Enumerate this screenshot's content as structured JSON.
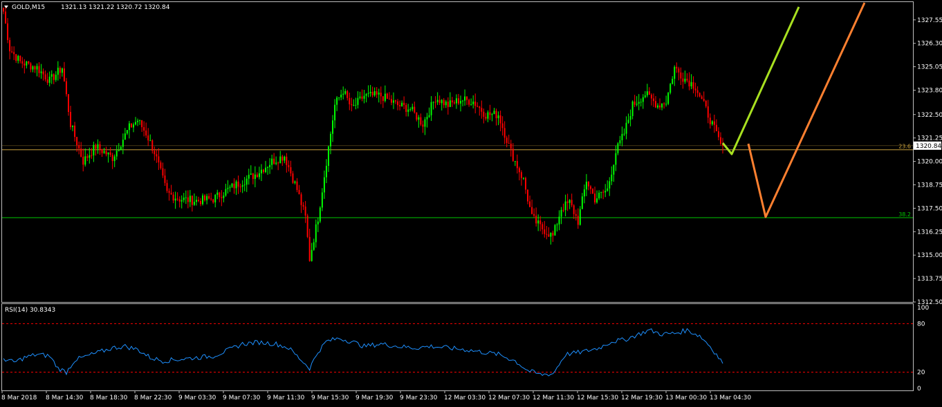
{
  "header": {
    "symbol": "GOLD,M15",
    "ohlc": "1321.13 1321.22 1320.72 1320.84"
  },
  "indicator": {
    "label": "RSI(14) 30.8343"
  },
  "colors": {
    "background": "#000000",
    "frame": "#c0c0c0",
    "bull": "#00ff00",
    "bear": "#ff0000",
    "rsi_line": "#1e90ff",
    "rsi_levels": "#ff0000",
    "fib_23": "#c8a03c",
    "fib_38": "#00c800",
    "arrow_up": "#a8e020",
    "arrow_down_up": "#ff8030"
  },
  "chart_data": [
    {
      "type": "candlestick",
      "title": "GOLD,M15",
      "ylim": [
        1312.5,
        1328.5
      ],
      "y_ticks": [
        "1327.55",
        "1326.30",
        "1325.05",
        "1323.80",
        "1322.50",
        "1321.25",
        "1320.00",
        "1318.75",
        "1317.50",
        "1316.25",
        "1315.00",
        "1313.75",
        "1312.50"
      ],
      "x_ticks": [
        "8 Mar 2018",
        "8 Mar 14:30",
        "8 Mar 18:30",
        "8 Mar 22:30",
        "9 Mar 03:30",
        "9 Mar 07:30",
        "9 Mar 11:30",
        "9 Mar 15:30",
        "9 Mar 19:30",
        "9 Mar 23:30",
        "12 Mar 03:30",
        "12 Mar 07:30",
        "12 Mar 11:30",
        "12 Mar 15:30",
        "12 Mar 19:30",
        "13 Mar 00:30",
        "13 Mar 04:30"
      ],
      "current_price": "1320.84",
      "levels": [
        {
          "label": "23.6",
          "value": 1320.62,
          "color": "#c8a03c"
        },
        {
          "label": "38.2",
          "value": 1317.0,
          "color": "#00c800"
        }
      ],
      "close_anchors": [
        [
          0,
          1328.0
        ],
        [
          3,
          1326.0
        ],
        [
          8,
          1325.3
        ],
        [
          16,
          1325.0
        ],
        [
          22,
          1324.3
        ],
        [
          28,
          1325.0
        ],
        [
          32,
          1322.0
        ],
        [
          38,
          1320.0
        ],
        [
          44,
          1320.8
        ],
        [
          52,
          1320.2
        ],
        [
          60,
          1321.8
        ],
        [
          64,
          1322.2
        ],
        [
          68,
          1321.5
        ],
        [
          72,
          1320.5
        ],
        [
          78,
          1318.3
        ],
        [
          84,
          1318.0
        ],
        [
          92,
          1317.9
        ],
        [
          100,
          1318.0
        ],
        [
          110,
          1318.7
        ],
        [
          120,
          1319.3
        ],
        [
          128,
          1320.0
        ],
        [
          134,
          1320.3
        ],
        [
          140,
          1318.5
        ],
        [
          144,
          1317.0
        ],
        [
          146,
          1314.8
        ],
        [
          150,
          1317.0
        ],
        [
          154,
          1320.0
        ],
        [
          158,
          1323.0
        ],
        [
          162,
          1323.8
        ],
        [
          166,
          1322.8
        ],
        [
          172,
          1323.5
        ],
        [
          180,
          1323.5
        ],
        [
          188,
          1323.0
        ],
        [
          194,
          1322.8
        ],
        [
          200,
          1322.0
        ],
        [
          206,
          1323.4
        ],
        [
          212,
          1323.0
        ],
        [
          218,
          1323.3
        ],
        [
          224,
          1323.2
        ],
        [
          230,
          1322.5
        ],
        [
          236,
          1322.5
        ],
        [
          242,
          1320.5
        ],
        [
          248,
          1319.0
        ],
        [
          252,
          1317.0
        ],
        [
          256,
          1316.5
        ],
        [
          262,
          1316.0
        ],
        [
          266,
          1317.5
        ],
        [
          270,
          1317.8
        ],
        [
          274,
          1316.8
        ],
        [
          278,
          1319.0
        ],
        [
          282,
          1318.0
        ],
        [
          288,
          1318.5
        ],
        [
          292,
          1320.5
        ],
        [
          296,
          1321.5
        ],
        [
          300,
          1323.0
        ],
        [
          306,
          1323.6
        ],
        [
          312,
          1323.0
        ],
        [
          316,
          1323.2
        ],
        [
          320,
          1325.0
        ],
        [
          324,
          1324.5
        ],
        [
          330,
          1324.0
        ],
        [
          336,
          1322.5
        ],
        [
          342,
          1320.9
        ],
        [
          343,
          1320.84
        ]
      ],
      "rsi": {
        "label": "RSI(14) 30.8343",
        "ylim": [
          0,
          100
        ],
        "y_ticks": [
          "100",
          "80",
          "20",
          "0"
        ],
        "levels": [
          80,
          20
        ],
        "anchors": [
          [
            0,
            37
          ],
          [
            5,
            32
          ],
          [
            10,
            38
          ],
          [
            16,
            42
          ],
          [
            22,
            40
          ],
          [
            26,
            25
          ],
          [
            30,
            20
          ],
          [
            34,
            35
          ],
          [
            40,
            40
          ],
          [
            46,
            45
          ],
          [
            52,
            50
          ],
          [
            58,
            52
          ],
          [
            64,
            48
          ],
          [
            70,
            38
          ],
          [
            76,
            34
          ],
          [
            84,
            36
          ],
          [
            92,
            38
          ],
          [
            100,
            40
          ],
          [
            108,
            48
          ],
          [
            114,
            55
          ],
          [
            122,
            57
          ],
          [
            130,
            55
          ],
          [
            136,
            50
          ],
          [
            142,
            35
          ],
          [
            146,
            25
          ],
          [
            150,
            45
          ],
          [
            154,
            58
          ],
          [
            160,
            62
          ],
          [
            166,
            58
          ],
          [
            172,
            52
          ],
          [
            180,
            55
          ],
          [
            188,
            52
          ],
          [
            196,
            50
          ],
          [
            204,
            52
          ],
          [
            212,
            50
          ],
          [
            220,
            48
          ],
          [
            228,
            45
          ],
          [
            236,
            42
          ],
          [
            244,
            34
          ],
          [
            250,
            22
          ],
          [
            256,
            17
          ],
          [
            262,
            18
          ],
          [
            268,
            42
          ],
          [
            276,
            45
          ],
          [
            284,
            50
          ],
          [
            290,
            58
          ],
          [
            296,
            60
          ],
          [
            302,
            66
          ],
          [
            308,
            72
          ],
          [
            314,
            67
          ],
          [
            320,
            68
          ],
          [
            326,
            72
          ],
          [
            332,
            65
          ],
          [
            336,
            55
          ],
          [
            340,
            42
          ],
          [
            343,
            31
          ]
        ]
      }
    }
  ],
  "drawings": {
    "up_arrow": [
      [
        1045,
        207
      ],
      [
        1058,
        223
      ],
      [
        1155,
        10
      ]
    ],
    "down_up_arrow": [
      [
        1082,
        208
      ],
      [
        1107,
        314
      ],
      [
        1250,
        4
      ]
    ]
  }
}
